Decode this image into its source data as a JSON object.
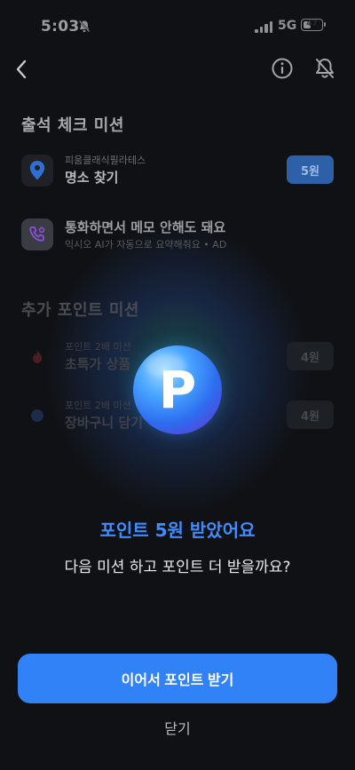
{
  "status_bar": {
    "time": "5:03",
    "network": "5G",
    "battery": "47",
    "battery_level": 0.47
  },
  "header": {
    "back_icon": "chevron-left-icon",
    "info_icon": "info-icon",
    "bell_icon": "bell-off-icon"
  },
  "attendance": {
    "title": "출석 체크 미션",
    "missions": [
      {
        "subtitle": "피움클래식필라테스",
        "name": "명소 찾기",
        "reward": "5원",
        "icon": "location-pin-icon"
      },
      {
        "name": "통화하면서 메모 안해도 돼요",
        "subtitle": "익시오 AI가 자동으로 요약해줘요 • AD",
        "icon": "phone-icon"
      }
    ]
  },
  "extra": {
    "title": "추가 포인트 미션",
    "missions": [
      {
        "subtitle": "포인트 2배 미션",
        "name": "초특가 상품",
        "reward": "4원"
      },
      {
        "subtitle": "포인트 2배 미션",
        "name": "장바구니 담기",
        "reward": "4원"
      }
    ]
  },
  "reward_modal": {
    "coin_letter": "P",
    "headline": "포인트 5원 받았어요",
    "subline": "다음 미션 하고 포인트 더 받을까요?",
    "cta_label": "이어서 포인트 받기",
    "close_label": "닫기"
  },
  "colors": {
    "accent": "#3182f6",
    "headline": "#3f8cff",
    "background": "#101114"
  }
}
